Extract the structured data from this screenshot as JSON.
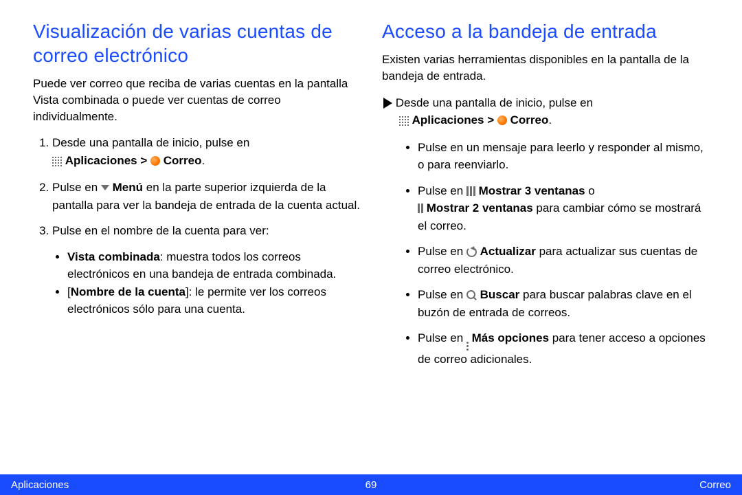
{
  "left": {
    "heading": "Visualización de varias cuentas de correo electrónico",
    "intro": "Puede ver correo que reciba de varias cuentas en la pantalla Vista combinada o puede ver cuentas de correo individualmente.",
    "step1_a": "Desde una pantalla de inicio, pulse en ",
    "step1_apps": "Aplicaciones",
    "step1_gt": " > ",
    "step1_mail": "Correo",
    "step1_dot": ".",
    "step2_a": "Pulse en ",
    "step2_menu": "Menú",
    "step2_b": " en la parte superior izquierda de la pantalla para ver la bandeja de entrada de la cuenta actual.",
    "step3": "Pulse en el nombre de la cuenta para ver:",
    "step3_b1_bold": "Vista combinada",
    "step3_b1_rest": ": muestra todos los correos electrónicos en una bandeja de entrada combinada.",
    "step3_b2_a": "[",
    "step3_b2_bold": "Nombre de la cuenta",
    "step3_b2_b": "]: le permite ver los correos electrónicos sólo para una cuenta."
  },
  "right": {
    "heading": "Acceso a la bandeja de entrada",
    "intro": "Existen varias herramientas disponibles en la pantalla de la bandeja de entrada.",
    "lead_a": "Desde una pantalla de inicio, pulse en ",
    "lead_apps": "Aplicaciones",
    "lead_gt": " > ",
    "lead_mail": "Correo",
    "lead_dot": ".",
    "b1": "Pulse en un mensaje para leerlo y responder al mismo, o para reenviarlo.",
    "b2_a": "Pulse en ",
    "b2_show3": "Mostrar 3 ventanas",
    "b2_mid": " o ",
    "b2_show2": "Mostrar 2 ventanas",
    "b2_end": " para cambiar cómo se mostrará el correo.",
    "b3_a": "Pulse en ",
    "b3_refresh": "Actualizar",
    "b3_end": " para actualizar sus cuentas de correo electrónico.",
    "b4_a": "Pulse en ",
    "b4_search": "Buscar",
    "b4_end": " para buscar palabras clave en el buzón de entrada de correos.",
    "b5_a": "Pulse en ",
    "b5_more": "Más opciones",
    "b5_end": " para tener acceso a opciones de correo adicionales."
  },
  "footer": {
    "left": "Aplicaciones",
    "center": "69",
    "right": "Correo"
  }
}
